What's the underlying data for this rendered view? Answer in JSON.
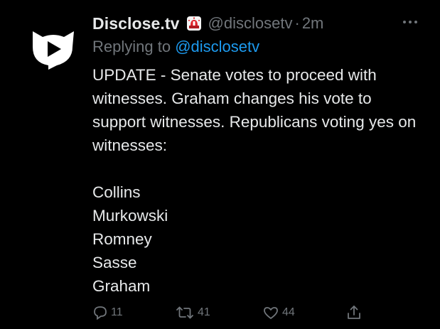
{
  "tweet": {
    "display_name": "Disclose.tv",
    "handle": "@disclosetv",
    "separator": "·",
    "time": "2m",
    "reply_prefix": "Replying to",
    "reply_handle": "@disclosetv",
    "body": "UPDATE - Senate votes to proceed with witnesses. Graham changes his vote to support witnesses. Republicans voting yes on witnesses:",
    "names": [
      "Collins",
      "Murkowski",
      "Romney",
      "Sasse",
      "Graham"
    ],
    "icons": {
      "avatar": "disclosetv-logo-icon",
      "badge": "police-siren-icon",
      "more": "more-options-icon"
    }
  },
  "actions": {
    "reply": {
      "icon": "reply-icon",
      "count": "11"
    },
    "retweet": {
      "icon": "retweet-icon",
      "count": "41"
    },
    "like": {
      "icon": "heart-icon",
      "count": "44"
    },
    "share": {
      "icon": "share-icon"
    }
  },
  "colors": {
    "background": "#000000",
    "text": "#e7e9ea",
    "muted": "#71767b",
    "link": "#1d9bf0",
    "siren_red": "#e0242c"
  }
}
